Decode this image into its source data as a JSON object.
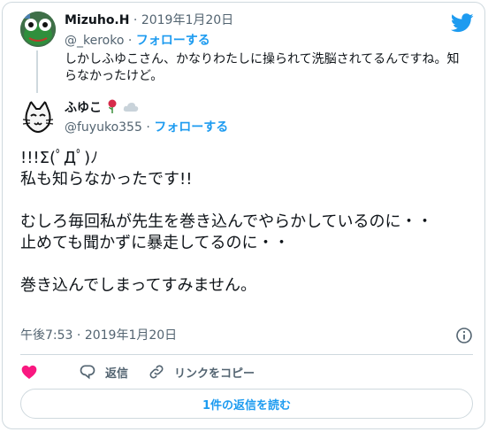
{
  "parent_tweet": {
    "name": "Mizuho.H",
    "separator": "·",
    "date": "2019年1月20日",
    "handle": "@_keroko",
    "follow_label": "フォローする",
    "text": "しかしふゆこさん、かなりわたしに操られて洗脳されてるんですね。知らなかったけど。"
  },
  "main_tweet": {
    "name": "ふゆこ",
    "handle": "@fuyuko355",
    "separator": "·",
    "follow_label": "フォローする",
    "body_lines": [
      "!!!Σ(ﾟДﾟ)ﾉ",
      "私も知らなかったです!!",
      "",
      "むしろ毎回私が先生を巻き込んでやらかしているのに・・",
      "止めても聞かずに暴走してるのに・・",
      "",
      "巻き込んでしまってすみません。"
    ],
    "time": "午後7:53",
    "date": "2019年1月20日",
    "time_separator": "·"
  },
  "actions": {
    "reply_label": "返信",
    "copy_link_label": "リンクをコピー"
  },
  "read_replies_label": "1件の返信を読む",
  "colors": {
    "accent": "#1d9bf0",
    "like": "#f91880",
    "text": "#0f1419",
    "secondary": "#536471",
    "border": "#cfd9de"
  },
  "icons": [
    "twitter-bird-icon",
    "info-icon",
    "heart-icon",
    "reply-icon",
    "link-icon",
    "rose-emoji-icon",
    "cloud-emoji-icon"
  ]
}
